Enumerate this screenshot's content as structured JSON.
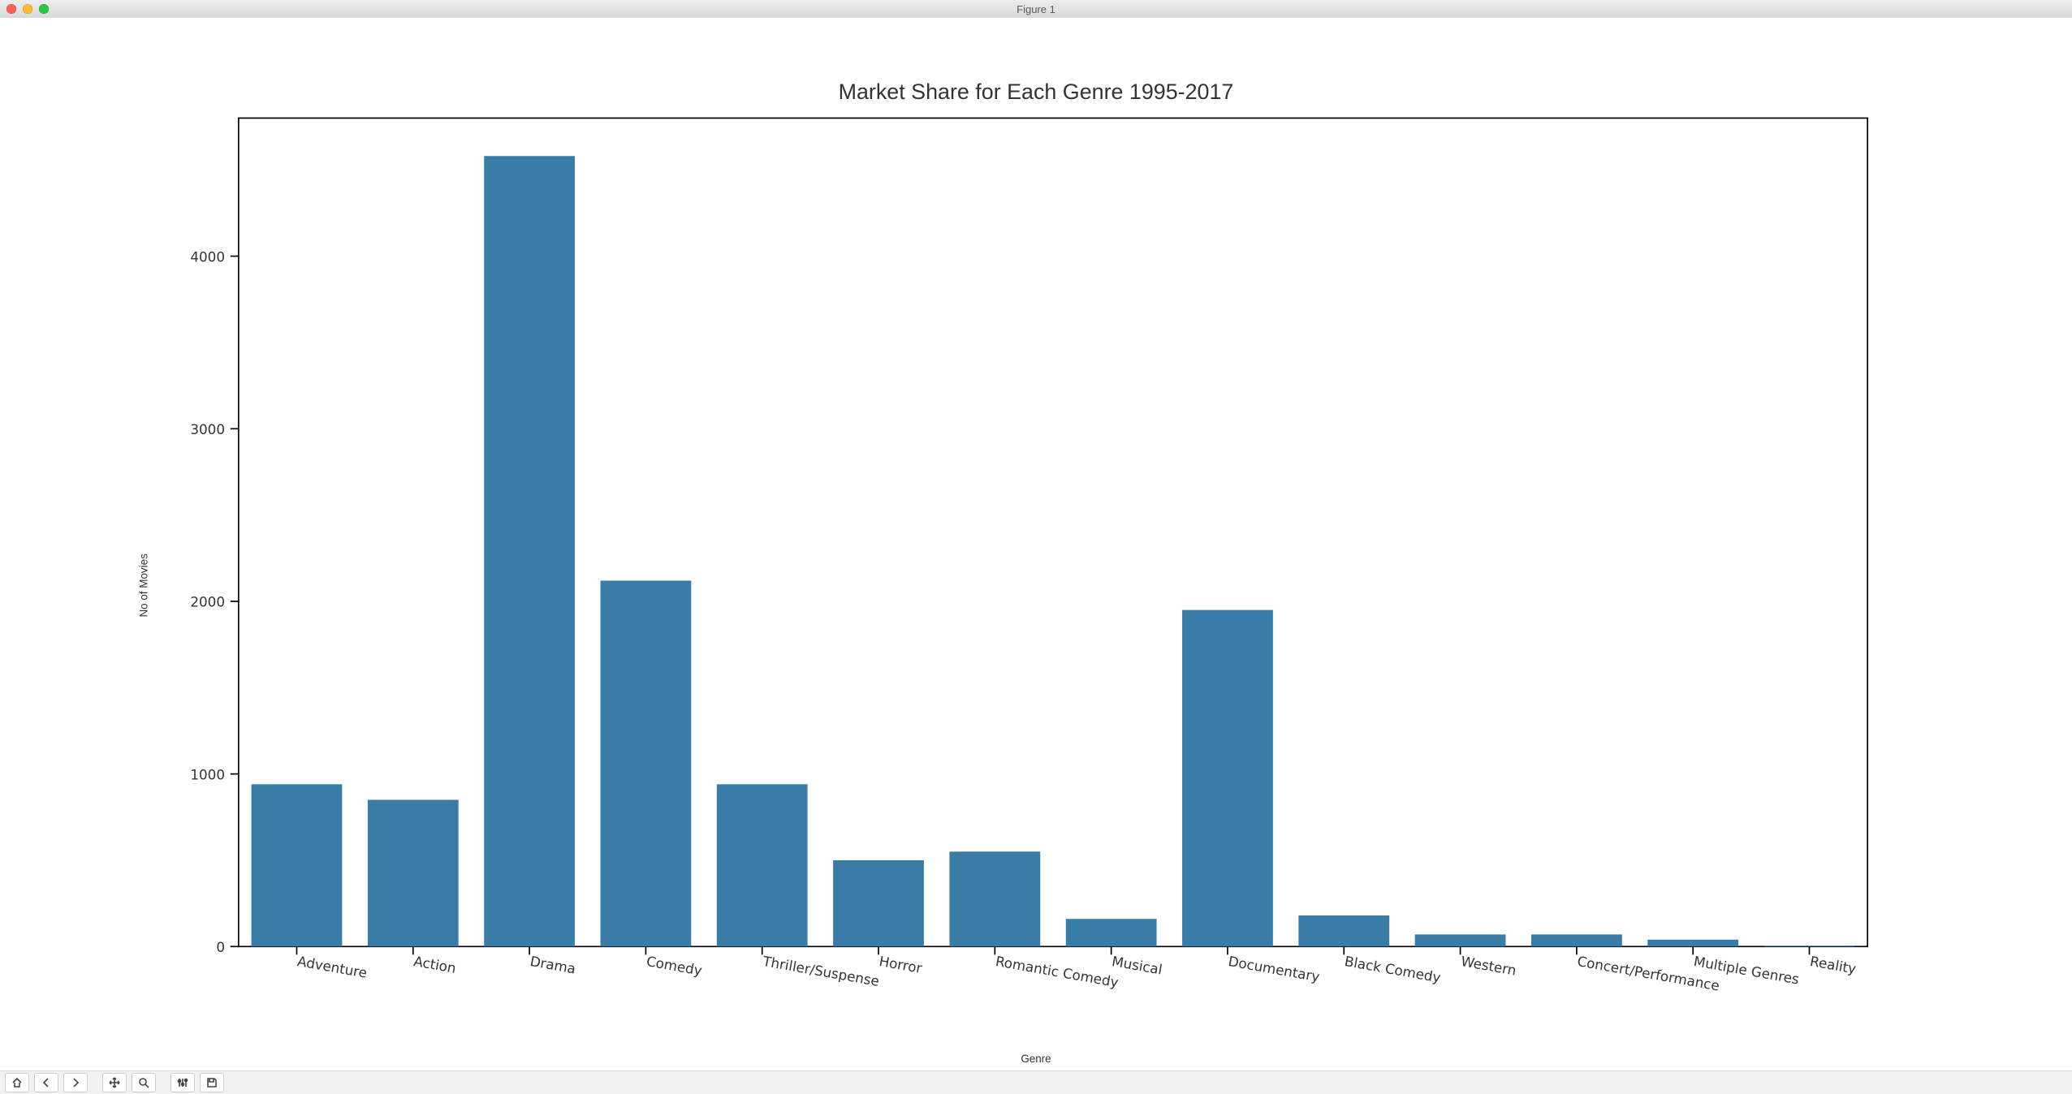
{
  "window": {
    "title": "Figure 1"
  },
  "chart_data": {
    "type": "bar",
    "title": "Market Share for Each Genre 1995-2017",
    "xlabel": "Genre",
    "ylabel": "No of Movies",
    "categories": [
      "Adventure",
      "Action",
      "Drama",
      "Comedy",
      "Thriller/Suspense",
      "Horror",
      "Romantic Comedy",
      "Musical",
      "Documentary",
      "Black Comedy",
      "Western",
      "Concert/Performance",
      "Multiple Genres",
      "Reality"
    ],
    "values": [
      940,
      850,
      4580,
      2120,
      940,
      500,
      550,
      160,
      1950,
      180,
      70,
      70,
      40,
      5
    ],
    "yticks": [
      0,
      1000,
      2000,
      3000,
      4000
    ],
    "ylim": [
      0,
      4800
    ],
    "bar_color": "#3a7ca8"
  },
  "toolbar": {
    "buttons": [
      "home",
      "back",
      "forward",
      "pan",
      "zoom",
      "subplots",
      "save"
    ]
  }
}
